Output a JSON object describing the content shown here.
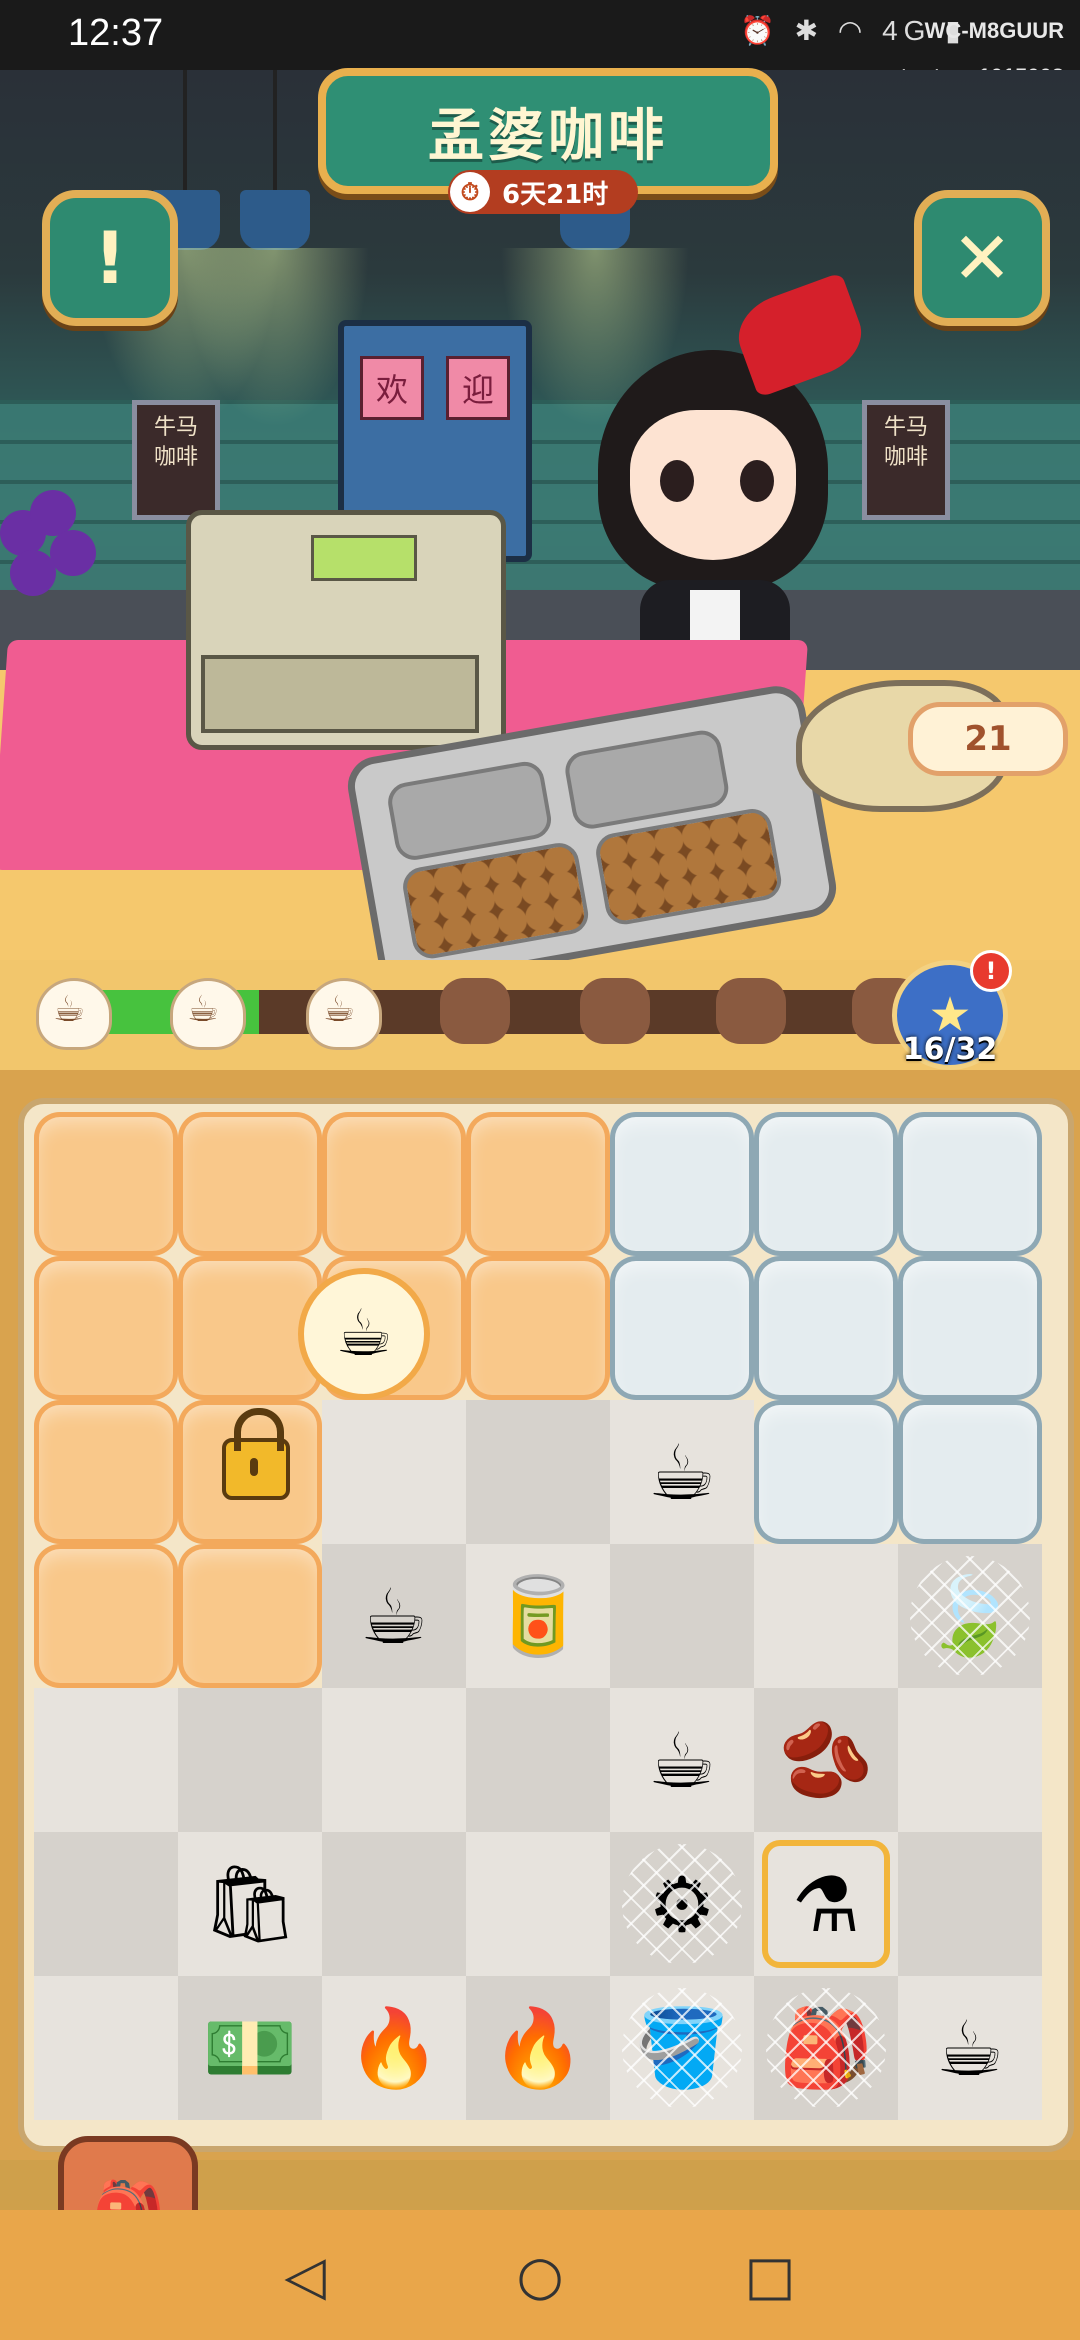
{
  "status_bar": {
    "time": "12:37",
    "icons": "⏰ ✱ ◠ 4G ▮",
    "carrier_id": "WC-M8GUUR",
    "account": "taptap_1015003"
  },
  "header": {
    "shop_name": "孟婆咖啡",
    "timer": "6天21时",
    "alert_icon": "!",
    "close_icon": "✕"
  },
  "scene": {
    "door_sign": [
      "欢",
      "迎"
    ],
    "menu_board_left": "牛马\n咖啡",
    "menu_board_right": "牛马\n咖啡",
    "counter_value": "21"
  },
  "progress": {
    "fraction": 0.24,
    "album_count": "16/32",
    "album_badge": "!"
  },
  "board": {
    "rows": [
      [
        "fog-orange",
        "fog-orange",
        "fog-orange",
        "fog-orange",
        "fog-blue",
        "fog-blue",
        "fog-blue"
      ],
      [
        "fog-orange",
        "fog-orange",
        "fog-orange",
        "fog-orange",
        "fog-blue",
        "fog-blue",
        "fog-blue"
      ],
      [
        "fog-orange",
        "fog-orange-lock",
        "light",
        "dark",
        "light:coffee-cup",
        "fog-blue",
        "fog-blue"
      ],
      [
        "fog-orange",
        "fog-orange",
        "dark:mug",
        "light:coffee-box",
        "dark",
        "light",
        "dark:tea-leaves-web"
      ],
      [
        "light",
        "dark",
        "light",
        "dark",
        "light:drip-bag-cup",
        "dark:bean-bowl",
        "light"
      ],
      [
        "dark",
        "light:coffee-bag",
        "dark",
        "light",
        "dark:grinder-web",
        "light:roaster-selected",
        "dark"
      ],
      [
        "light",
        "dark:cash",
        "light:blue-flame",
        "dark:blue-flame",
        "light:pot-web",
        "dark:machine-web",
        "light:latte-cup"
      ]
    ],
    "item_glyphs": {
      "coffee-cup": "☕",
      "mug": "☕",
      "coffee-box": "🥫",
      "tea-leaves-web": "🍃",
      "drip-bag-cup": "☕",
      "bean-bowl": "🫘",
      "coffee-bag": "🛍",
      "grinder-web": "⚙",
      "roaster-selected": "⚗",
      "cash": "💵",
      "blue-flame": "🔥",
      "pot-web": "🪣",
      "machine-web": "🎒",
      "latte-cup": "☕"
    },
    "order_bubble_item": "☕"
  },
  "backpack_icon": "🎒",
  "nav": {
    "back": "◁",
    "home": "○",
    "recent": "□"
  }
}
